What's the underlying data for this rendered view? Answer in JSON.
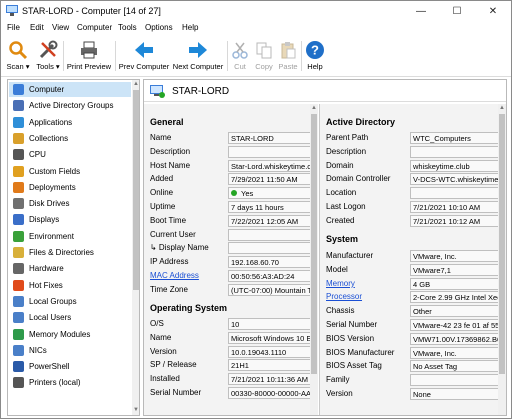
{
  "window": {
    "title": "STAR-LORD - Computer [14 of 27]",
    "minimize": "—",
    "maximize": "☐",
    "close": "✕"
  },
  "menu": [
    "File",
    "Edit",
    "View",
    "Computer",
    "Tools",
    "Options",
    "Help"
  ],
  "toolbar": {
    "scan": "Scan ▾",
    "tools": "Tools ▾",
    "print_preview": "Print Preview",
    "prev_computer": "Prev Computer",
    "next_computer": "Next Computer",
    "cut": "Cut",
    "copy": "Copy",
    "paste": "Paste",
    "help": "Help"
  },
  "sidebar": {
    "items": [
      {
        "label": "Computer",
        "icon": "computer-icon",
        "color": "#3b7dd8"
      },
      {
        "label": "Active Directory Groups",
        "icon": "ad-groups-icon",
        "color": "#4a6fb5"
      },
      {
        "label": "Applications",
        "icon": "applications-icon",
        "color": "#2f8fd8"
      },
      {
        "label": "Collections",
        "icon": "collections-icon",
        "color": "#d9a02b"
      },
      {
        "label": "CPU",
        "icon": "cpu-icon",
        "color": "#555555"
      },
      {
        "label": "Custom Fields",
        "icon": "custom-fields-icon",
        "color": "#e0a020"
      },
      {
        "label": "Deployments",
        "icon": "deployments-icon",
        "color": "#e07a1a"
      },
      {
        "label": "Disk Drives",
        "icon": "disk-drives-icon",
        "color": "#707070"
      },
      {
        "label": "Displays",
        "icon": "displays-icon",
        "color": "#3a6ec8"
      },
      {
        "label": "Environment",
        "icon": "environment-icon",
        "color": "#3aa13a"
      },
      {
        "label": "Files & Directories",
        "icon": "files-icon",
        "color": "#d8b03a"
      },
      {
        "label": "Hardware",
        "icon": "hardware-icon",
        "color": "#666666"
      },
      {
        "label": "Hot Fixes",
        "icon": "hot-fixes-icon",
        "color": "#e04a1a"
      },
      {
        "label": "Local Groups",
        "icon": "local-groups-icon",
        "color": "#4a7fc8"
      },
      {
        "label": "Local Users",
        "icon": "local-users-icon",
        "color": "#4a7fc8"
      },
      {
        "label": "Memory Modules",
        "icon": "memory-icon",
        "color": "#2e9a4a"
      },
      {
        "label": "NICs",
        "icon": "nics-icon",
        "color": "#4a7fc8"
      },
      {
        "label": "PowerShell",
        "icon": "powershell-icon",
        "color": "#2a5aa8"
      },
      {
        "label": "Printers (local)",
        "icon": "printers-icon",
        "color": "#555555"
      }
    ]
  },
  "header": {
    "computer_name": "STAR-LORD"
  },
  "general": {
    "title": "General",
    "rows": [
      {
        "key": "Name",
        "value": "STAR-LORD"
      },
      {
        "key": "Description",
        "value": ""
      },
      {
        "key": "Host Name",
        "value": "Star-Lord.whiskeytime.c"
      },
      {
        "key": "Added",
        "value": "7/29/2021 11:50 AM"
      },
      {
        "key": "Online",
        "value": "Yes"
      },
      {
        "key": "Uptime",
        "value": "7 days 11 hours"
      },
      {
        "key": "Boot Time",
        "value": "7/22/2021 12:05 AM"
      },
      {
        "key": "Current User",
        "value": ""
      },
      {
        "key": "↳ Display Name",
        "value": ""
      },
      {
        "key": "IP Address",
        "value": "192.168.60.70"
      },
      {
        "key": "MAC Address",
        "value": "00:50:56:A3:AD:24"
      },
      {
        "key": "Time Zone",
        "value": "(UTC-07:00) Mountain T"
      }
    ]
  },
  "os": {
    "title": "Operating System",
    "rows": [
      {
        "key": "O/S",
        "value": "10"
      },
      {
        "key": "Name",
        "value": "Microsoft Windows 10 E"
      },
      {
        "key": "Version",
        "value": "10.0.19043.1110"
      },
      {
        "key": "SP / Release",
        "value": "21H1"
      },
      {
        "key": "Installed",
        "value": "7/21/2021 10:11:36 AM"
      },
      {
        "key": "Serial Number",
        "value": "00330-80000-00000-AA"
      }
    ]
  },
  "ad": {
    "title": "Active Directory",
    "rows": [
      {
        "key": "Parent Path",
        "value": "WTC_Computers"
      },
      {
        "key": "Description",
        "value": ""
      },
      {
        "key": "Domain",
        "value": "whiskeytime.club"
      },
      {
        "key": "Domain Controller",
        "value": "V-DCS-WTC.whiskeytime.clu"
      },
      {
        "key": "Location",
        "value": ""
      },
      {
        "key": "Last Logon",
        "value": "7/21/2021 10:10 AM"
      },
      {
        "key": "Created",
        "value": "7/21/2021 10:12 AM"
      }
    ]
  },
  "system": {
    "title": "System",
    "rows": [
      {
        "key": "Manufacturer",
        "value": "VMware, Inc."
      },
      {
        "key": "Model",
        "value": "VMware7,1"
      },
      {
        "key": "Memory",
        "value": "4 GB"
      },
      {
        "key": "Processor",
        "value": "2-Core 2.99 GHz Intel Xeon"
      },
      {
        "key": "Chassis",
        "value": "Other"
      },
      {
        "key": "Serial Number",
        "value": "VMware-42 23 fe 01 af 55 r"
      },
      {
        "key": "BIOS Version",
        "value": "VMW71.00V.17369862.B64"
      },
      {
        "key": "BIOS Manufacturer",
        "value": "VMware, Inc."
      },
      {
        "key": "BIOS Asset Tag",
        "value": "No Asset Tag"
      },
      {
        "key": "Family",
        "value": ""
      },
      {
        "key": "Version",
        "value": "None"
      }
    ]
  }
}
